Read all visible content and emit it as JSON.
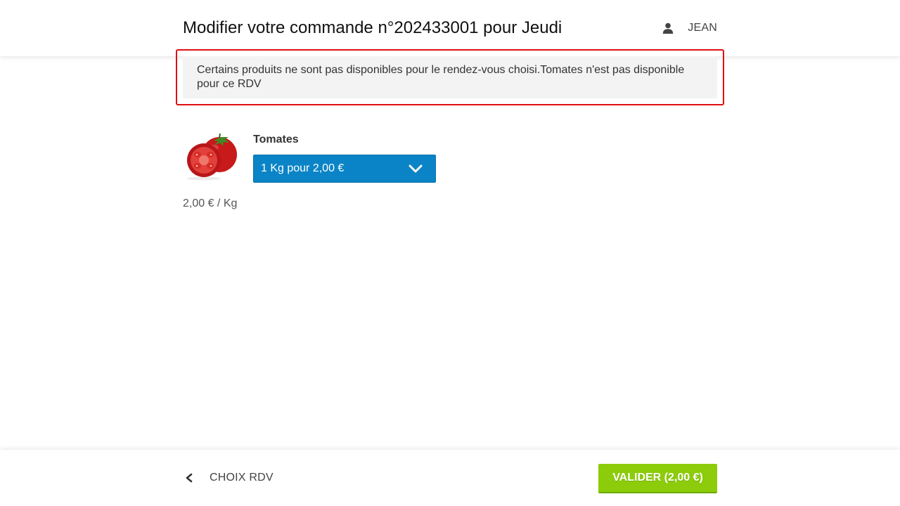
{
  "header": {
    "title": "Modifier votre commande n°202433001 pour Jeudi",
    "user_name": "JEAN",
    "user_icon": "user-icon"
  },
  "alert": {
    "message": "Certains produits ne sont pas disponibles pour le rendez-vous choisi.Tomates n'est pas disponible pour ce RDV",
    "border_color": "#e01010"
  },
  "product": {
    "name": "Tomates",
    "image": "tomatoes-image",
    "selected_variant": "1 Kg pour 2,00 €",
    "unit_price": "2,00 € / Kg",
    "select_color": "#0a84c6"
  },
  "footer": {
    "back_label": "CHOIX RDV",
    "back_icon": "chevron-left-icon",
    "validate_label": "VALIDER (2,00 €)",
    "validate_color": "#8ccc0a"
  }
}
